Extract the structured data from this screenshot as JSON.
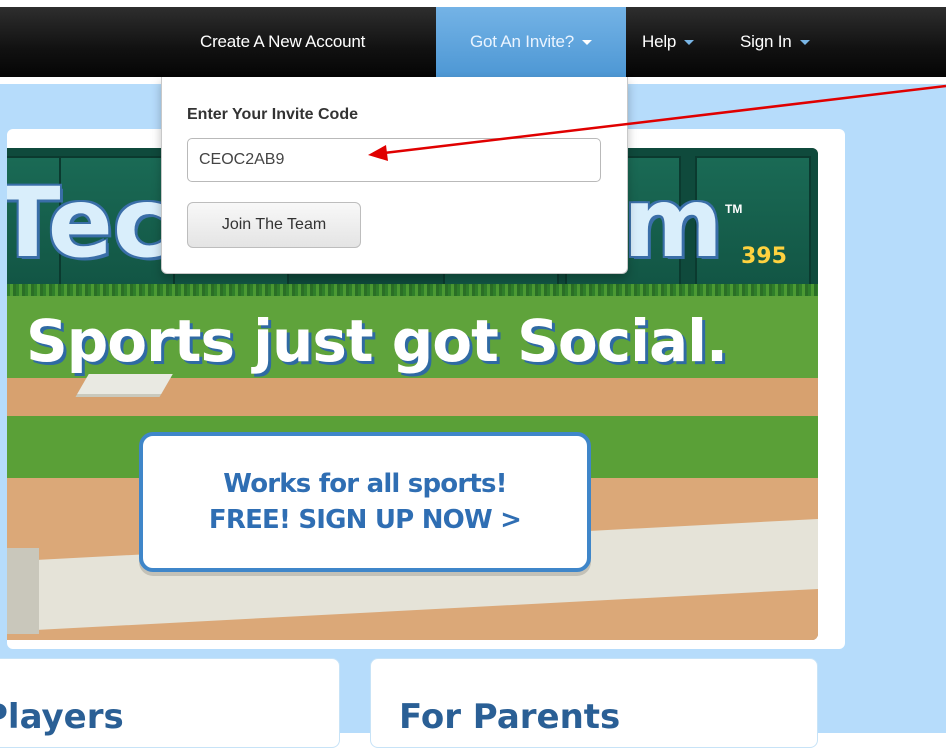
{
  "nav": {
    "create_account": "Create A New Account",
    "got_invite": "Got An Invite?",
    "help": "Help",
    "sign_in": "Sign In"
  },
  "invite_popup": {
    "label": "Enter Your Invite Code",
    "input_value": "CEOC2AB9",
    "button": "Join The Team"
  },
  "hero": {
    "logo_left": "Tec",
    "logo_right": "m",
    "trademark": "TM",
    "score": "395",
    "tagline": "Sports just got Social.",
    "cta_line1": "Works for all sports!",
    "cta_line2": "FREE! SIGN UP NOW >"
  },
  "cards": {
    "players": "Players",
    "parents": "For Parents"
  },
  "colors": {
    "navbar": "#111111",
    "active_tab": "#5aa3dc",
    "page_background": "#b6dcfb",
    "annotation_arrow": "#e00000"
  }
}
